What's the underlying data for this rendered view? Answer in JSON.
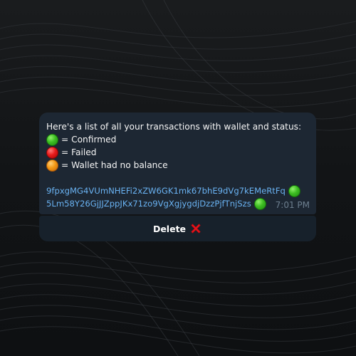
{
  "message": {
    "intro": "Here's a list of all your transactions with wallet and status:",
    "legend": [
      {
        "status": "confirmed",
        "color": "#3dbd22",
        "label": "= Confirmed"
      },
      {
        "status": "failed",
        "color": "#e81b1b",
        "label": "= Failed"
      },
      {
        "status": "no_balance",
        "color": "#f59a15",
        "label": "= Wallet had no balance"
      }
    ],
    "transactions": [
      {
        "wallet": "9fpxgMG4VUmNHEFi2xZW6GK1mk67bhE9dVg7kEMeRtFq",
        "status": "confirmed"
      },
      {
        "wallet": "5Lm58Y26GjJJZppJKx71zo9VgXgjygdjDzzPjfTnjSzs",
        "status": "confirmed"
      }
    ],
    "time": "7:01 PM"
  },
  "delete_button": {
    "label": "Delete",
    "icon": "red-cross-icon"
  }
}
